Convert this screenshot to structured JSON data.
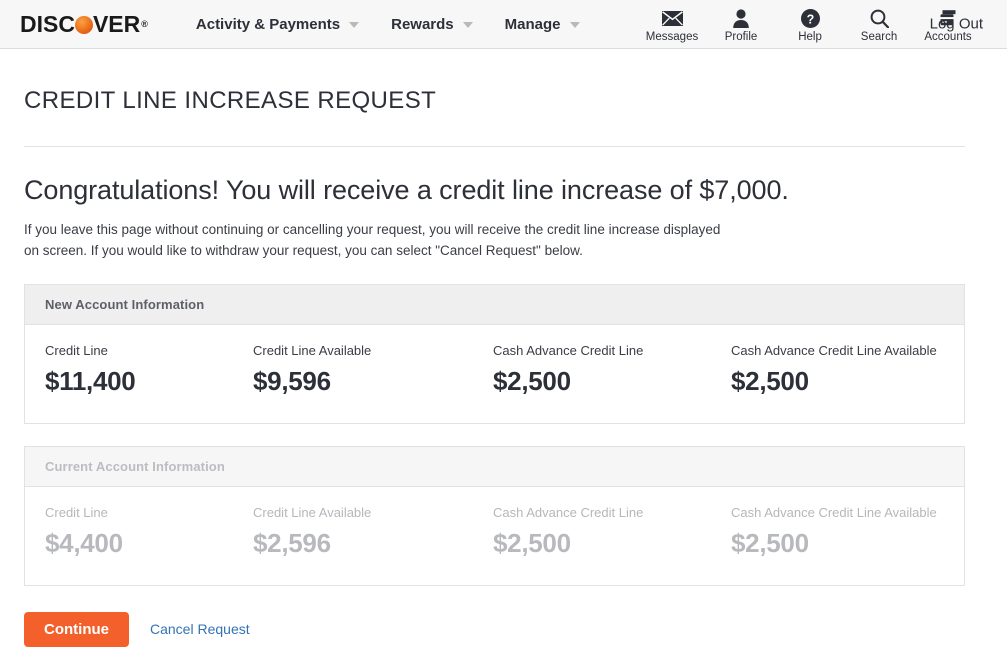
{
  "header": {
    "brand": {
      "text_before": "DISC",
      "sphere": "O",
      "text_after": "VER",
      "trademark": "®"
    },
    "nav": [
      {
        "label": "Activity & Payments",
        "has_caret": true
      },
      {
        "label": "Rewards",
        "has_caret": true
      },
      {
        "label": "Manage",
        "has_caret": true
      }
    ],
    "icons": [
      {
        "label": "Messages",
        "icon": "envelope-icon"
      },
      {
        "label": "Profile",
        "icon": "person-icon"
      },
      {
        "label": "Help",
        "icon": "question-circle-icon"
      },
      {
        "label": "Search",
        "icon": "search-icon"
      },
      {
        "label": "Accounts",
        "icon": "cards-icon"
      }
    ],
    "logout_label": "Log Out"
  },
  "page": {
    "title": "CREDIT LINE INCREASE REQUEST",
    "headline": "Congratulations! You will receive a credit line increase of $7,000.",
    "subtext": "If you leave this page without continuing or cancelling your request, you will receive the credit line increase displayed on screen. If you would like to withdraw your request, you can select \"Cancel Request\" below."
  },
  "new_account": {
    "heading": "New Account Information",
    "stats": [
      {
        "label": "Credit Line",
        "value": "$11,400"
      },
      {
        "label": "Credit Line Available",
        "value": "$9,596"
      },
      {
        "label": "Cash Advance Credit Line",
        "value": "$2,500"
      },
      {
        "label": "Cash Advance Credit Line Available",
        "value": "$2,500"
      }
    ]
  },
  "current_account": {
    "heading": "Current Account Information",
    "stats": [
      {
        "label": "Credit Line",
        "value": "$4,400"
      },
      {
        "label": "Credit Line Available",
        "value": "$2,596"
      },
      {
        "label": "Cash Advance Credit Line",
        "value": "$2,500"
      },
      {
        "label": "Cash Advance Credit Line Available",
        "value": "$2,500"
      }
    ]
  },
  "actions": {
    "continue_label": "Continue",
    "cancel_label": "Cancel Request"
  },
  "colors": {
    "brand_orange": "#f4602c",
    "link_blue": "#3273b5",
    "text_dark": "#2d3038",
    "muted_grey": "#b7b9bd",
    "panel_header_bg": "#efefef"
  }
}
